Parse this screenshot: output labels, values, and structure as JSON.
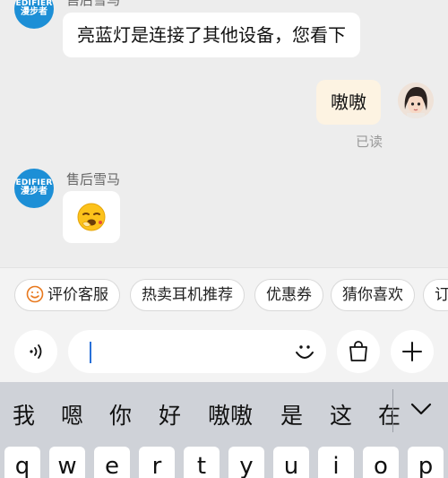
{
  "messages": [
    {
      "side": "left",
      "sender": "售后雪马",
      "text": "亮蓝灯是连接了其他设备，您看下"
    },
    {
      "side": "right",
      "text": "嗷嗷",
      "status": "已读"
    },
    {
      "side": "left",
      "sender": "售后雪马",
      "emoji": "yawning-face"
    }
  ],
  "brand_avatar": {
    "line1": "EDIFIER",
    "line2": "漫步者",
    "color": "#1d8fd6"
  },
  "quick_replies": [
    "评价客服",
    "热卖耳机推荐",
    "优惠券",
    "猜你喜欢",
    "订"
  ],
  "input": {
    "value": ""
  },
  "candidates": [
    "我",
    "嗯",
    "你",
    "好",
    "嗷嗷",
    "是",
    "这",
    "在"
  ],
  "keyboard_row1": [
    "q",
    "w",
    "e",
    "r",
    "t",
    "y",
    "u",
    "i",
    "o",
    "p"
  ],
  "icons": {
    "voice": "voice-input-icon",
    "emoji": "emoji-icon",
    "shop": "shopping-bag-icon",
    "plus": "plus-icon",
    "collapse": "chevron-down-icon"
  },
  "colors": {
    "accent": "#2870d8",
    "my_bubble": "#fdf3e2",
    "smile": "#e8791e"
  }
}
